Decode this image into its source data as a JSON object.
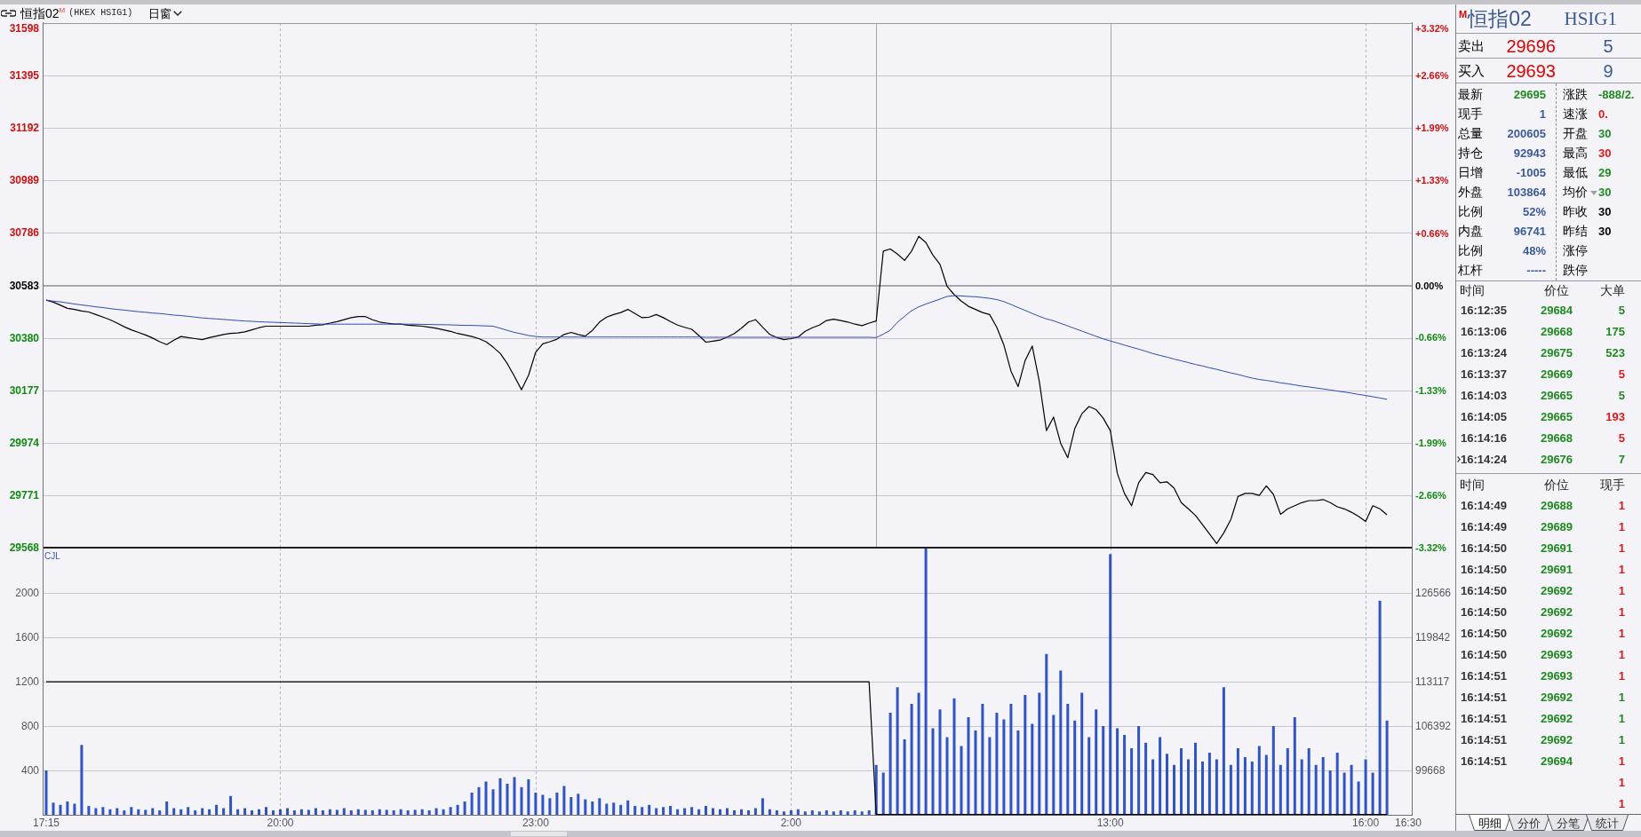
{
  "header": {
    "title": "恒指02",
    "badge": "M",
    "code": "(HKEX HSIG1)",
    "period": "日窗"
  },
  "price_chart": {
    "chart_data": {
      "type": "line",
      "grid": true,
      "categories": [
        null,
        null,
        null,
        null,
        null,
        null,
        null,
        null,
        null,
        null,
        null,
        null,
        null,
        null,
        null,
        null,
        null,
        null,
        null,
        null,
        null,
        null,
        null,
        null,
        null,
        null,
        null,
        null,
        null,
        null,
        null,
        null,
        null,
        null,
        null,
        null,
        null,
        null,
        null,
        null,
        null,
        null,
        null,
        null,
        null,
        null,
        null,
        null,
        null,
        null,
        null,
        null,
        null,
        null,
        null,
        null,
        null,
        null,
        null,
        null,
        null,
        null,
        null,
        null,
        null,
        null,
        null,
        null,
        null,
        null,
        null,
        null,
        null,
        null,
        null,
        null,
        null,
        null,
        null,
        null,
        null,
        null,
        null,
        null,
        null,
        null,
        null,
        null,
        null,
        null,
        null,
        null,
        null,
        null,
        null,
        null,
        null,
        null,
        null,
        null,
        null,
        null,
        null,
        null,
        null,
        null,
        null,
        null,
        null,
        null,
        null,
        null,
        null,
        null,
        null,
        null,
        null,
        null,
        null,
        null,
        null,
        null,
        null,
        null,
        null,
        null,
        null,
        null,
        null,
        null,
        null,
        null,
        null,
        null,
        null,
        null,
        null,
        null,
        null,
        null,
        null,
        null,
        null,
        null,
        null,
        null,
        null,
        null,
        null,
        null,
        null,
        null,
        null,
        null,
        null,
        null,
        null,
        null,
        null,
        null,
        null,
        null,
        null,
        null,
        null,
        null,
        null,
        null,
        null,
        null,
        null,
        null,
        null,
        null,
        null,
        null,
        null,
        null,
        null,
        null,
        null,
        null,
        null,
        null,
        null,
        null,
        null,
        null,
        null,
        null,
        null,
        null,
        null
      ],
      "series": [
        {
          "color": "#000000",
          "values": [
            30526,
            30518,
            30506,
            30494,
            30490,
            30484,
            30480,
            30470,
            30460,
            30450,
            30437,
            30423,
            30411,
            30401,
            30391,
            30379,
            30365,
            30354,
            30371,
            30385,
            30381,
            30377,
            30373,
            30381,
            30387,
            30393,
            30397,
            30399,
            30403,
            30411,
            30419,
            30425,
            30425,
            30425,
            30425,
            30425,
            30425,
            30425,
            30429,
            30431,
            30437,
            30443,
            30450,
            30458,
            30462,
            30462,
            30450,
            30441,
            30437,
            30433,
            30433,
            30429,
            30427,
            30425,
            30421,
            30417,
            30411,
            30405,
            30397,
            30391,
            30385,
            30377,
            30365,
            30344,
            30320,
            30280,
            30231,
            30179,
            30235,
            30324,
            30357,
            30365,
            30375,
            30393,
            30401,
            30393,
            30387,
            30409,
            30441,
            30460,
            30470,
            30478,
            30490,
            30474,
            30458,
            30460,
            30470,
            30458,
            30443,
            30429,
            30421,
            30413,
            30389,
            30363,
            30367,
            30371,
            30383,
            30397,
            30417,
            30441,
            30450,
            30421,
            30393,
            30381,
            30373,
            30377,
            30383,
            30405,
            30419,
            30429,
            30447,
            30452,
            30447,
            30441,
            30433,
            30427,
            30437,
            30445,
            30716,
            30724,
            30704,
            30680,
            30716,
            30773,
            30749,
            30700,
            30664,
            30579,
            30547,
            30522,
            30502,
            30490,
            30478,
            30470,
            30421,
            30352,
            30251,
            30191,
            30292,
            30348,
            30211,
            30021,
            30073,
            29972,
            29916,
            30029,
            30086,
            30114,
            30102,
            30069,
            30021,
            29855,
            29778,
            29730,
            29819,
            29859,
            29851,
            29819,
            29823,
            29798,
            29742,
            29718,
            29693,
            29657,
            29621,
            29584,
            29625,
            29677,
            29766,
            29778,
            29778,
            29770,
            29807,
            29774,
            29697,
            29718,
            29730,
            29742,
            29750,
            29750,
            29754,
            29742,
            29726,
            29718,
            29705,
            29689,
            29669,
            29730,
            29718,
            29695,
            null,
            null,
            null
          ]
        },
        {
          "color": "#2b4cb3",
          "values": [
            30526,
            30522,
            30519,
            30515,
            30511,
            30507,
            30504,
            30500,
            30497,
            30493,
            30490,
            30487,
            30484,
            30481,
            30479,
            30476,
            30474,
            30471,
            30468,
            30466,
            30463,
            30460,
            30457,
            30455,
            30453,
            30451,
            30449,
            30447,
            30445,
            30444,
            30442,
            30441,
            30440,
            30439,
            30438,
            30437,
            30436,
            30435,
            30434,
            30433,
            30433,
            30433,
            30433,
            30433,
            30433,
            30433,
            30433,
            30433,
            30433,
            30433,
            30433,
            30433,
            30433,
            30432,
            30432,
            30431,
            30431,
            30430,
            30429,
            30428,
            30428,
            30427,
            30426,
            30425,
            30417,
            30409,
            30401,
            30395,
            30389,
            30385,
            30383,
            30383,
            30383,
            30383,
            30383,
            30383,
            30383,
            30383,
            30383,
            30383,
            30383,
            30383,
            30383,
            30383,
            30383,
            30383,
            30383,
            30383,
            30383,
            30383,
            30383,
            30383,
            30383,
            30382,
            30382,
            30382,
            30382,
            30382,
            30382,
            30382,
            30382,
            30382,
            30382,
            30382,
            30382,
            30382,
            30382,
            30382,
            30382,
            30382,
            30382,
            30382,
            30382,
            30382,
            30382,
            30382,
            30382,
            30381,
            30394,
            30410,
            30440,
            30463,
            30485,
            30500,
            30511,
            30520,
            30530,
            30540,
            30543,
            30542,
            30540,
            30539,
            30536,
            30533,
            30528,
            30520,
            30509,
            30497,
            30486,
            30474,
            30463,
            30453,
            30446,
            30436,
            30426,
            30416,
            30406,
            30396,
            30386,
            30376,
            30368,
            30360,
            30352,
            30344,
            30336,
            30328,
            30319,
            30312,
            30305,
            30298,
            30291,
            30284,
            30277,
            30271,
            30264,
            30258,
            30251,
            30244,
            30238,
            30231,
            30224,
            30219,
            30215,
            30211,
            30206,
            30202,
            30198,
            30193,
            30190,
            30186,
            30182,
            30178,
            30174,
            30170,
            30166,
            30161,
            30157,
            30152,
            30147,
            30142,
            null,
            null,
            null
          ]
        }
      ],
      "ylim": [
        29568,
        31598
      ],
      "yticks": [
        31598,
        31395,
        31192,
        30989,
        30786,
        30583,
        30380,
        30177,
        29974,
        29771,
        29568
      ],
      "y2lim": [
        -3.32,
        3.32
      ],
      "y2ticks": [
        {
          "value": 3.32,
          "label": "+3.32%"
        },
        {
          "value": 2.66,
          "label": "+2.66%"
        },
        {
          "value": 1.99,
          "label": "+1.99%"
        },
        {
          "value": 1.33,
          "label": "+1.33%"
        },
        {
          "value": 0.66,
          "label": "+0.66%"
        },
        {
          "value": 0,
          "label": "0.00%"
        },
        {
          "value": -0.66,
          "label": "-0.66%"
        },
        {
          "value": -1.33,
          "label": "-1.33%"
        },
        {
          "value": -1.99,
          "label": "-1.99%"
        },
        {
          "value": -2.66,
          "label": "-2.66%"
        },
        {
          "value": -3.32,
          "label": "-3.32%"
        }
      ],
      "ref_lines": [
        {
          "axis": "y",
          "value": 30583
        }
      ]
    }
  },
  "volume_chart": {
    "chart_data": {
      "type": "bar",
      "title": "CJL",
      "grid": true,
      "categories": [
        "17:15",
        null,
        null,
        null,
        null,
        null,
        null,
        null,
        null,
        null,
        null,
        null,
        null,
        null,
        null,
        null,
        null,
        null,
        null,
        null,
        null,
        null,
        null,
        null,
        null,
        null,
        null,
        null,
        null,
        null,
        null,
        null,
        null,
        "20:00",
        null,
        null,
        null,
        null,
        null,
        null,
        null,
        null,
        null,
        null,
        null,
        null,
        null,
        null,
        null,
        null,
        null,
        null,
        null,
        null,
        null,
        null,
        null,
        null,
        null,
        null,
        null,
        null,
        null,
        null,
        null,
        null,
        null,
        null,
        null,
        "23:00",
        null,
        null,
        null,
        null,
        null,
        null,
        null,
        null,
        null,
        null,
        null,
        null,
        null,
        null,
        null,
        null,
        null,
        null,
        null,
        null,
        null,
        null,
        null,
        null,
        null,
        null,
        null,
        null,
        null,
        null,
        null,
        null,
        null,
        null,
        null,
        "2:00",
        null,
        null,
        null,
        null,
        null,
        null,
        null,
        null,
        null,
        null,
        null,
        null,
        null,
        null,
        null,
        null,
        null,
        null,
        null,
        null,
        null,
        null,
        null,
        null,
        null,
        null,
        null,
        null,
        null,
        null,
        null,
        null,
        null,
        null,
        null,
        null,
        null,
        null,
        null,
        null,
        null,
        null,
        null,
        null,
        "13:00",
        null,
        null,
        null,
        null,
        null,
        null,
        null,
        null,
        null,
        null,
        null,
        null,
        null,
        null,
        null,
        null,
        null,
        null,
        null,
        null,
        null,
        null,
        null,
        null,
        null,
        null,
        null,
        null,
        null,
        null,
        null,
        null,
        null,
        null,
        null,
        "16:00",
        null,
        null,
        null,
        null,
        null,
        "16:30"
      ],
      "series": [
        {
          "color": "#3154c4",
          "values": [
            400,
            110,
            90,
            120,
            100,
            630,
            80,
            60,
            70,
            50,
            60,
            40,
            70,
            50,
            45,
            60,
            40,
            120,
            60,
            50,
            70,
            40,
            60,
            50,
            90,
            60,
            170,
            50,
            60,
            40,
            50,
            70,
            40,
            50,
            60,
            40,
            50,
            45,
            60,
            40,
            50,
            45,
            60,
            40,
            50,
            45,
            40,
            50,
            45,
            40,
            50,
            40,
            45,
            50,
            40,
            60,
            50,
            70,
            90,
            120,
            200,
            250,
            300,
            230,
            330,
            280,
            340,
            250,
            320,
            200,
            180,
            150,
            200,
            260,
            160,
            190,
            140,
            120,
            150,
            100,
            110,
            90,
            130,
            80,
            70,
            90,
            60,
            70,
            80,
            50,
            60,
            70,
            50,
            80,
            60,
            50,
            60,
            40,
            50,
            40,
            60,
            150,
            50,
            40,
            30,
            40,
            50,
            30,
            40,
            30,
            40,
            30,
            40,
            30,
            40,
            30,
            40,
            450,
            380,
            920,
            1150,
            680,
            1000,
            1100,
            2400,
            780,
            950,
            700,
            1050,
            620,
            880,
            760,
            1000,
            700,
            920,
            860,
            1000,
            760,
            1080,
            820,
            1100,
            1450,
            900,
            1300,
            1000,
            850,
            1100,
            700,
            950,
            800,
            2350,
            780,
            720,
            600,
            800,
            650,
            500,
            700,
            550,
            450,
            600,
            500,
            650,
            480,
            560,
            500,
            1150,
            450,
            600,
            520,
            480,
            620,
            540,
            800,
            450,
            600,
            880,
            500,
            600,
            450,
            520,
            400,
            560,
            380,
            450,
            300,
            500,
            380,
            1930,
            850,
            null,
            null,
            null
          ]
        }
      ],
      "ylim": [
        0,
        2400
      ],
      "yticks": [
        400,
        800,
        1200,
        1600,
        2000
      ]
    }
  },
  "open_interest_chart": {
    "chart_data": {
      "type": "line",
      "categories": [
        null,
        null,
        null,
        null,
        null,
        null,
        null,
        null,
        null,
        null,
        null,
        null,
        null,
        null,
        null,
        null,
        null,
        null,
        null,
        null,
        null,
        null,
        null,
        null,
        null,
        null,
        null,
        null,
        null,
        null,
        null,
        null,
        null,
        null,
        null,
        null,
        null,
        null,
        null,
        null,
        null,
        null,
        null,
        null,
        null,
        null,
        null,
        null,
        null,
        null,
        null,
        null,
        null,
        null,
        null,
        null,
        null,
        null,
        null,
        null,
        null,
        null,
        null,
        null,
        null,
        null,
        null,
        null,
        null,
        null,
        null,
        null,
        null,
        null,
        null,
        null,
        null,
        null,
        null,
        null,
        null,
        null,
        null,
        null,
        null,
        null,
        null,
        null,
        null,
        null,
        null,
        null,
        null,
        null,
        null,
        null,
        null,
        null,
        null,
        null,
        null,
        null,
        null,
        null,
        null,
        null,
        null,
        null,
        null,
        null,
        null,
        null,
        null,
        null,
        null,
        null,
        null,
        null,
        null,
        null,
        null,
        null,
        null,
        null,
        null,
        null,
        null,
        null,
        null,
        null,
        null,
        null,
        null,
        null,
        null,
        null,
        null,
        null,
        null,
        null,
        null,
        null,
        null,
        null,
        null,
        null,
        null,
        null,
        null,
        null,
        null,
        null,
        null,
        null,
        null,
        null,
        null,
        null,
        null,
        null,
        null,
        null,
        null,
        null,
        null,
        null,
        null,
        null,
        null,
        null,
        null,
        null,
        null,
        null,
        null,
        null,
        null,
        null,
        null,
        null,
        null,
        null,
        null,
        null,
        null,
        null,
        null,
        null,
        null,
        null,
        null,
        null,
        null
      ],
      "series": [
        {
          "color": "#000000",
          "values": [
            113100,
            113100,
            113100,
            113100,
            113100,
            113100,
            113100,
            113100,
            113100,
            113100,
            113100,
            113100,
            113100,
            113100,
            113100,
            113100,
            113100,
            113100,
            113100,
            113100,
            113100,
            113100,
            113100,
            113100,
            113100,
            113100,
            113100,
            113100,
            113100,
            113100,
            113100,
            113100,
            113100,
            113100,
            113100,
            113100,
            113100,
            113100,
            113100,
            113100,
            113100,
            113100,
            113100,
            113100,
            113100,
            113100,
            113100,
            113100,
            113100,
            113100,
            113100,
            113100,
            113100,
            113100,
            113100,
            113100,
            113100,
            113100,
            113100,
            113100,
            113100,
            113100,
            113100,
            113100,
            113100,
            113100,
            113100,
            113100,
            113100,
            113100,
            113100,
            113100,
            113100,
            113100,
            113100,
            113100,
            113100,
            113100,
            113100,
            113100,
            113100,
            113100,
            113100,
            113100,
            113100,
            113100,
            113100,
            113100,
            113100,
            113100,
            113100,
            113100,
            113100,
            113100,
            113100,
            113100,
            113100,
            113100,
            113100,
            113100,
            113100,
            113100,
            113100,
            113100,
            113100,
            113100,
            113100,
            113100,
            113100,
            113100,
            113100,
            113100,
            113100,
            113100,
            113100,
            113100,
            113100,
            93000,
            93000,
            93000,
            93000,
            93000,
            93000,
            93000,
            93000,
            93000,
            93000,
            93000,
            93000,
            93000,
            93000,
            93000,
            93000,
            93000,
            93000,
            93000,
            93000,
            93000,
            93000,
            93000,
            93000,
            93000,
            93000,
            93000,
            93000,
            93000,
            93000,
            93000,
            93000,
            93000,
            93000,
            93000,
            93000,
            93000,
            93000,
            93000,
            93000,
            93000,
            93000,
            93000,
            93000,
            93000,
            93000,
            93000,
            93000,
            93000,
            93000,
            93000,
            93000,
            93000,
            93000,
            93000,
            93000,
            93000,
            93000,
            93000,
            93000,
            93000,
            93000,
            93000,
            93000,
            93000,
            93000,
            93000,
            93000,
            93000,
            93000,
            93000,
            93000,
            93000,
            null,
            null,
            null
          ]
        }
      ],
      "ylim": [
        92943,
        133292
      ],
      "yticks": [
        99668,
        106392,
        113117,
        119842,
        126566
      ]
    }
  },
  "quote": {
    "badge": "M",
    "title": "恒指02",
    "code": "HSIG1",
    "ask": {
      "label": "卖出",
      "price": "29696",
      "qty": "5"
    },
    "bid": {
      "label": "买入",
      "price": "29693",
      "qty": "9"
    },
    "stats_left": [
      {
        "label": "最新",
        "value": "29695",
        "color": "#1f8a1f"
      },
      {
        "label": "现手",
        "value": "1",
        "color": "#3a5a9a"
      },
      {
        "label": "总量",
        "value": "200605",
        "color": "#3a5a9a"
      },
      {
        "label": "持仓",
        "value": "92943",
        "color": "#3a5a9a"
      },
      {
        "label": "日增",
        "value": "-1005",
        "color": "#3a5a9a"
      },
      {
        "label": "外盘",
        "value": "103864",
        "color": "#3a5a9a"
      },
      {
        "label": "比例",
        "value": "52%",
        "color": "#3a5a9a"
      },
      {
        "label": "内盘",
        "value": "96741",
        "color": "#3a5a9a"
      },
      {
        "label": "比例",
        "value": "48%",
        "color": "#3a5a9a"
      },
      {
        "label": "杠杆",
        "value": "-----",
        "color": "#3a5a9a"
      }
    ],
    "stats_right": [
      {
        "label": "涨跌",
        "value": "-888/2.",
        "color": "#1f8a1f",
        "menu": false
      },
      {
        "label": "速涨",
        "value": "0.",
        "color": "#e01818",
        "menu": false
      },
      {
        "label": "开盘",
        "value": "30",
        "color": "#1f8a1f",
        "menu": false
      },
      {
        "label": "最高",
        "value": "30",
        "color": "#e01818",
        "menu": false
      },
      {
        "label": "最低",
        "value": "29",
        "color": "#1f8a1f",
        "menu": false
      },
      {
        "label": "均价",
        "value": "30",
        "color": "#1f8a1f",
        "menu": true
      },
      {
        "label": "昨收",
        "value": "30",
        "color": "#000000",
        "menu": false
      },
      {
        "label": "昨结",
        "value": "30",
        "color": "#000000",
        "menu": false
      },
      {
        "label": "涨停",
        "menu": false
      },
      {
        "label": "跌停",
        "menu": false
      }
    ]
  },
  "big_orders": {
    "columns": [
      "时间",
      "价位",
      "大单"
    ],
    "rows": [
      {
        "time": "16:12:35",
        "price": "29684",
        "qty": "5",
        "color": "#1f8a1f",
        "selected": false
      },
      {
        "time": "16:13:06",
        "price": "29668",
        "qty": "175",
        "color": "#1f8a1f",
        "selected": false
      },
      {
        "time": "16:13:24",
        "price": "29675",
        "qty": "523",
        "color": "#1f8a1f",
        "selected": false
      },
      {
        "time": "16:13:37",
        "price": "29669",
        "qty": "5",
        "color": "#e01818",
        "selected": false
      },
      {
        "time": "16:14:03",
        "price": "29665",
        "qty": "5",
        "color": "#1f8a1f",
        "selected": false
      },
      {
        "time": "16:14:05",
        "price": "29665",
        "qty": "193",
        "color": "#e01818",
        "selected": false
      },
      {
        "time": "16:14:16",
        "price": "29668",
        "qty": "5",
        "color": "#e01818",
        "selected": false
      },
      {
        "time": "16:14:24",
        "price": "29676",
        "qty": "7",
        "color": "#1f8a1f",
        "selected": true
      }
    ]
  },
  "trades": {
    "columns": [
      "时间",
      "价位",
      "现手"
    ],
    "rows": [
      {
        "time": "16:14:49",
        "price": "29688",
        "qty": "1",
        "color": "#e01818"
      },
      {
        "time": "16:14:49",
        "price": "29689",
        "qty": "1",
        "color": "#e01818"
      },
      {
        "time": "16:14:50",
        "price": "29691",
        "qty": "1",
        "color": "#e01818"
      },
      {
        "time": "16:14:50",
        "price": "29691",
        "qty": "1",
        "color": "#e01818"
      },
      {
        "time": "16:14:50",
        "price": "29692",
        "qty": "1",
        "color": "#e01818"
      },
      {
        "time": "16:14:50",
        "price": "29692",
        "qty": "1",
        "color": "#e01818"
      },
      {
        "time": "16:14:50",
        "price": "29692",
        "qty": "1",
        "color": "#e01818"
      },
      {
        "time": "16:14:50",
        "price": "29693",
        "qty": "1",
        "color": "#e01818"
      },
      {
        "time": "16:14:51",
        "price": "29693",
        "qty": "1",
        "color": "#e01818"
      },
      {
        "time": "16:14:51",
        "price": "29692",
        "qty": "1",
        "color": "#1f8a1f"
      },
      {
        "time": "16:14:51",
        "price": "29692",
        "qty": "1",
        "color": "#1f8a1f"
      },
      {
        "time": "16:14:51",
        "price": "29692",
        "qty": "1",
        "color": "#1f8a1f"
      },
      {
        "time": "16:14:51",
        "price": "29694",
        "qty": "1",
        "color": "#e01818"
      },
      {
        "qty": "1",
        "color": "#e01818"
      },
      {
        "qty": "1",
        "color": "#e01818"
      }
    ]
  },
  "tabs": [
    {
      "label": "明细",
      "selected": true
    },
    {
      "label": "分价",
      "selected": false
    },
    {
      "label": "分笔",
      "selected": false
    },
    {
      "label": "统计",
      "selected": false
    }
  ]
}
